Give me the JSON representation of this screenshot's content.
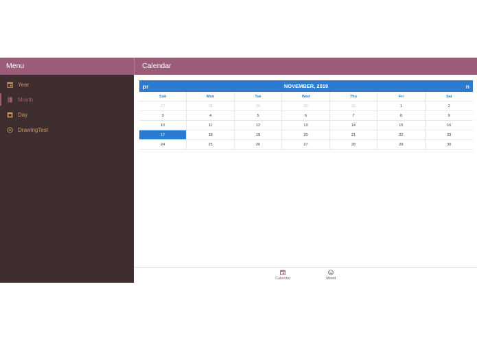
{
  "sidebar": {
    "title": "Menu",
    "items": [
      {
        "label": "Year",
        "icon": "calendar-icon"
      },
      {
        "label": "Month",
        "icon": "book-icon",
        "active": true
      },
      {
        "label": "Day",
        "icon": "calendar-day-icon"
      },
      {
        "label": "DrawingTest",
        "icon": "play-circle-icon"
      }
    ]
  },
  "main": {
    "title": "Calendar"
  },
  "calendar": {
    "month_title": "NOVEMBER, 2019",
    "prev_label": "pr",
    "next_label": "n",
    "weekdays": [
      "Sun",
      "Mon",
      "Tue",
      "Wed",
      "Thu",
      "Fri",
      "Sat"
    ],
    "weeks": [
      [
        "27",
        "28",
        "29",
        "30",
        "31",
        "1",
        "2"
      ],
      [
        "3",
        "4",
        "5",
        "6",
        "7",
        "8",
        "9"
      ],
      [
        "10",
        "11",
        "12",
        "13",
        "14",
        "15",
        "16"
      ],
      [
        "17",
        "18",
        "19",
        "20",
        "21",
        "22",
        "23"
      ],
      [
        "24",
        "25",
        "26",
        "27",
        "28",
        "29",
        "30"
      ]
    ],
    "selected_day": "17"
  },
  "bottom_nav": {
    "items": [
      {
        "label": "Calendar",
        "icon": "calendar-icon",
        "active": true
      },
      {
        "label": "Mood",
        "icon": "smiley-icon"
      }
    ]
  },
  "colors": {
    "header": "#9a5c79",
    "sidebar_bg": "#3f2e2f",
    "sidebar_text": "#c99a63",
    "calendar_accent": "#2b7bd1"
  }
}
